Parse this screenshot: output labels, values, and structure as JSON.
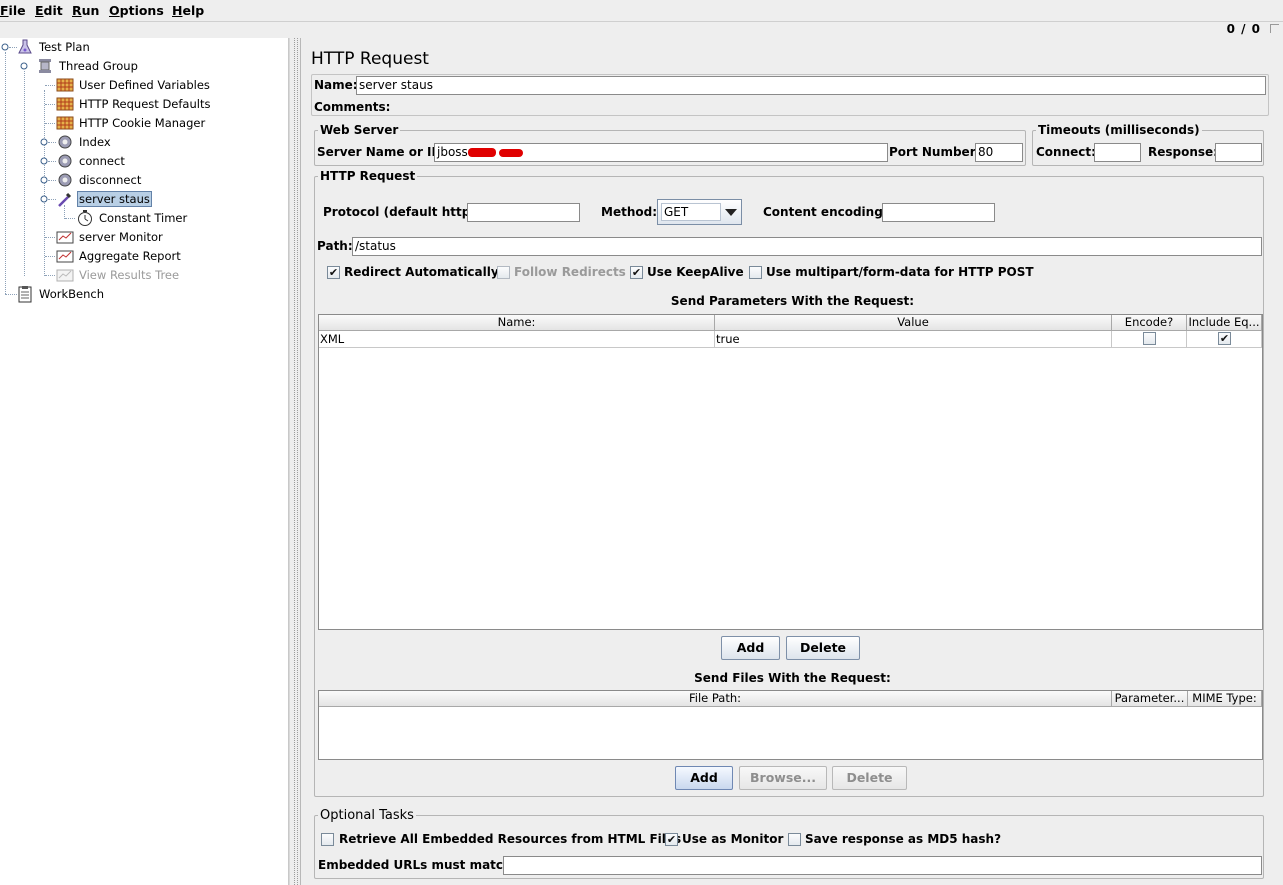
{
  "menu": [
    "File",
    "Edit",
    "Run",
    "Options",
    "Help"
  ],
  "status": {
    "counter": "0 / 0"
  },
  "tree": {
    "items": [
      {
        "label": "Test Plan",
        "icon": "flask-icon"
      },
      {
        "label": "Thread Group",
        "icon": "spool-icon"
      },
      {
        "label": "User Defined Variables",
        "icon": "config-grid-icon"
      },
      {
        "label": "HTTP Request Defaults",
        "icon": "config-grid-icon"
      },
      {
        "label": "HTTP Cookie Manager",
        "icon": "config-grid-icon"
      },
      {
        "label": "Index",
        "icon": "controller-icon"
      },
      {
        "label": "connect",
        "icon": "controller-icon"
      },
      {
        "label": "disconnect",
        "icon": "controller-icon"
      },
      {
        "label": "server staus",
        "icon": "sampler-pipette-icon"
      },
      {
        "label": "Constant Timer",
        "icon": "stopwatch-icon"
      },
      {
        "label": "server Monitor",
        "icon": "graph-listener-icon"
      },
      {
        "label": "Aggregate Report",
        "icon": "graph-listener-icon"
      },
      {
        "label": "View Results Tree",
        "icon": "graph-listener-icon"
      },
      {
        "label": "WorkBench",
        "icon": "clipboard-icon"
      }
    ]
  },
  "panel": {
    "title": "HTTP Request",
    "name_label": "Name:",
    "name_value": "server staus",
    "comments_label": "Comments:",
    "web_server": {
      "legend": "Web Server",
      "server_label": "Server Name or IP:",
      "server_value": "jboss.",
      "port_label": "Port Number:",
      "port_value": "80"
    },
    "timeouts": {
      "legend": "Timeouts (milliseconds)",
      "connect_label": "Connect:",
      "connect_value": "",
      "response_label": "Response:",
      "response_value": ""
    },
    "http_request": {
      "legend": "HTTP Request",
      "protocol_label": "Protocol (default http):",
      "protocol_value": "",
      "method_label": "Method:",
      "method_value": "GET",
      "encoding_label": "Content encoding:",
      "encoding_value": "",
      "path_label": "Path:",
      "path_value": "/status",
      "options": {
        "redirect_auto": {
          "label": "Redirect Automatically",
          "checked": true
        },
        "follow_redirects": {
          "label": "Follow Redirects",
          "checked": false
        },
        "keepalive": {
          "label": "Use KeepAlive",
          "checked": true
        },
        "multipart": {
          "label": "Use multipart/form-data for HTTP POST",
          "checked": false
        }
      }
    },
    "params": {
      "heading": "Send Parameters With the Request:",
      "columns": [
        "Name:",
        "Value",
        "Encode?",
        "Include Eq..."
      ],
      "rows": [
        {
          "name": "XML",
          "value": "true",
          "encode": false,
          "include_eq": true
        }
      ],
      "add_label": "Add",
      "delete_label": "Delete"
    },
    "files": {
      "heading": "Send Files With the Request:",
      "columns": [
        "File Path:",
        "Parameter...",
        "MIME Type:"
      ],
      "add_label": "Add",
      "browse_label": "Browse...",
      "delete_label": "Delete"
    },
    "optional": {
      "legend": "Optional Tasks",
      "retrieve": {
        "label": "Retrieve All Embedded Resources from HTML Files",
        "checked": false
      },
      "monitor": {
        "label": "Use as Monitor",
        "checked": true
      },
      "md5": {
        "label": "Save response as MD5 hash?",
        "checked": false
      },
      "embedded_label": "Embedded URLs must match:",
      "embedded_value": ""
    }
  }
}
